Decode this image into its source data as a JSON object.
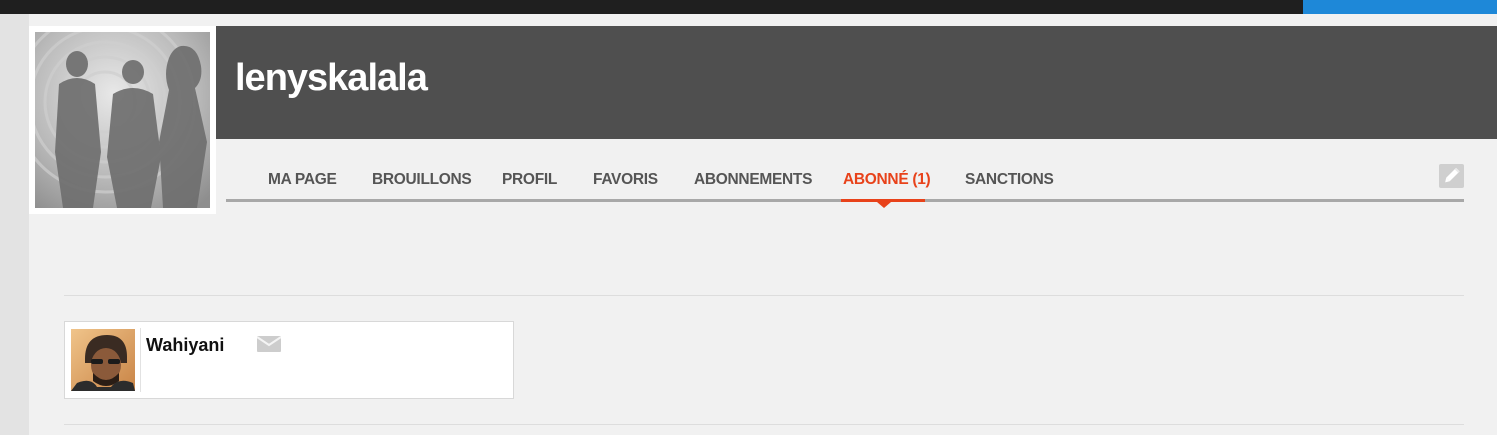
{
  "profile": {
    "username": "lenyskalala"
  },
  "nav": {
    "items": [
      {
        "label": "MA PAGE",
        "active": false
      },
      {
        "label": "BROUILLONS",
        "active": false
      },
      {
        "label": "PROFIL",
        "active": false
      },
      {
        "label": "FAVORIS",
        "active": false
      },
      {
        "label": "ABONNEMENTS",
        "active": false
      },
      {
        "label": "ABONNÉ (1)",
        "active": true
      },
      {
        "label": "SANCTIONS",
        "active": false
      }
    ],
    "edit_icon": "pencil-icon"
  },
  "subscribers": [
    {
      "name": "Wahiyani",
      "message_icon": "envelope-icon"
    }
  ],
  "colors": {
    "accent": "#e8421a",
    "header_band": "#4f4f4f",
    "topbar": "#1f1f1f",
    "topbar_accent": "#1e88d8",
    "nav_text": "#555555"
  }
}
